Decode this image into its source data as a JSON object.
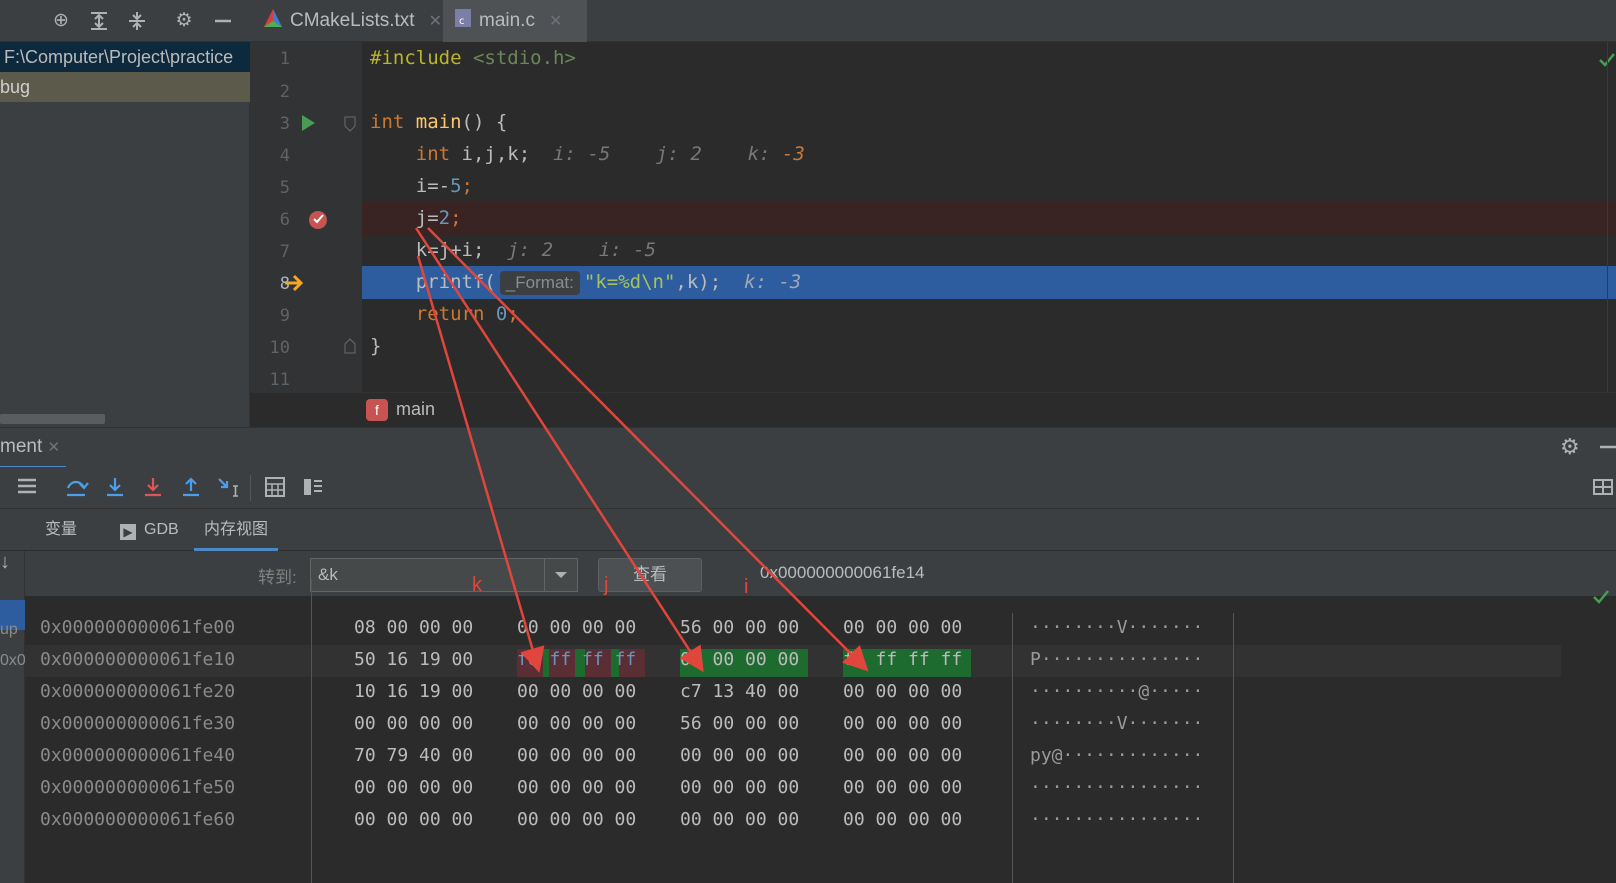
{
  "toolbar": {
    "icons": [
      "crosshair-icon",
      "expand-all-icon",
      "collapse-all-icon",
      "gear-icon",
      "minimize-icon"
    ]
  },
  "tabs": [
    {
      "label": "CMakeLists.txt",
      "icon": "cmake-icon",
      "active": false
    },
    {
      "label": "main.c",
      "icon": "c-file-icon",
      "active": true
    }
  ],
  "project": {
    "path": "F:\\Computer\\Project\\practice",
    "item": "bug"
  },
  "editor": {
    "line_numbers": [
      "1",
      "2",
      "3",
      "4",
      "5",
      "6",
      "7",
      "8",
      "9",
      "10",
      "11"
    ],
    "lines": {
      "l1_inc": "#include",
      "l1_hdr": "<stdio.h>",
      "l3_kw": "int",
      "l3_fn": "main",
      "l3_rest": "() {",
      "l4_kw": "int",
      "l4_rest": "i,j,k;",
      "l4_hint_i": "i: -5",
      "l4_hint_j": "j: 2",
      "l4_hint_k_lbl": "k:",
      "l4_hint_k_val": "-3",
      "l5_a": "i=-",
      "l5_num": "5",
      "l5_end": ";",
      "l6_a": "j=",
      "l6_num": "2",
      "l6_end": ";",
      "l7_code": "k=j+i;",
      "l7_hint_j": "j: 2",
      "l7_hint_i": "i: -5",
      "l8_fn": "printf(",
      "l8_param": "_Format:",
      "l8_str": "\"k=%d\\n\"",
      "l8_rest": ",k);",
      "l8_hint": "k: -3",
      "l9_kw": "return",
      "l9_num": "0",
      "l9_end": ";",
      "l10": "}"
    }
  },
  "breadcrumb": {
    "badge": "f",
    "label": "main"
  },
  "debug": {
    "window_tab": "ment",
    "tabs": [
      {
        "label": "变量"
      },
      {
        "label": "GDB"
      },
      {
        "label": "内存视图"
      }
    ],
    "goto_label": "转到:",
    "goto_value": "&k",
    "view_button": "查看",
    "current_address": "0x000000000061fe14",
    "column_labels": {
      "k": "k",
      "j": "j",
      "i": "i"
    },
    "left_fragments": [
      "up",
      "0x0"
    ]
  },
  "memory": {
    "rows": [
      {
        "addr": "0x000000000061fe00",
        "g1": "08 00 00 00",
        "g2": "00 00 00 00",
        "g3": "56 00 00 00",
        "g4": "00 00 00 00",
        "ascii": "········V·······"
      },
      {
        "addr": "0x000000000061fe10",
        "g1": "50 16 19 00",
        "g2": "fd ff ff ff",
        "g3": "02 00 00 00",
        "g4": "fb ff ff ff",
        "ascii": "P···············"
      },
      {
        "addr": "0x000000000061fe20",
        "g1": "10 16 19 00",
        "g2": "00 00 00 00",
        "g3": "c7 13 40 00",
        "g4": "00 00 00 00",
        "ascii": "··········@·····"
      },
      {
        "addr": "0x000000000061fe30",
        "g1": "00 00 00 00",
        "g2": "00 00 00 00",
        "g3": "56 00 00 00",
        "g4": "00 00 00 00",
        "ascii": "········V·······"
      },
      {
        "addr": "0x000000000061fe40",
        "g1": "70 79 40 00",
        "g2": "00 00 00 00",
        "g3": "00 00 00 00",
        "g4": "00 00 00 00",
        "ascii": "py@·············"
      },
      {
        "addr": "0x000000000061fe50",
        "g1": "00 00 00 00",
        "g2": "00 00 00 00",
        "g3": "00 00 00 00",
        "g4": "00 00 00 00",
        "ascii": "················"
      },
      {
        "addr": "0x000000000061fe60",
        "g1": "00 00 00 00",
        "g2": "00 00 00 00",
        "g3": "00 00 00 00",
        "g4": "00 00 00 00",
        "ascii": "················"
      }
    ]
  },
  "colors": {
    "accent": "#4a88c7",
    "breakpoint_line": "#3a2323",
    "current_line": "#2d5d9f",
    "annotation_red": "#e0463c",
    "highlight_green": "#1e6b30",
    "highlight_red": "#5a2e34"
  }
}
